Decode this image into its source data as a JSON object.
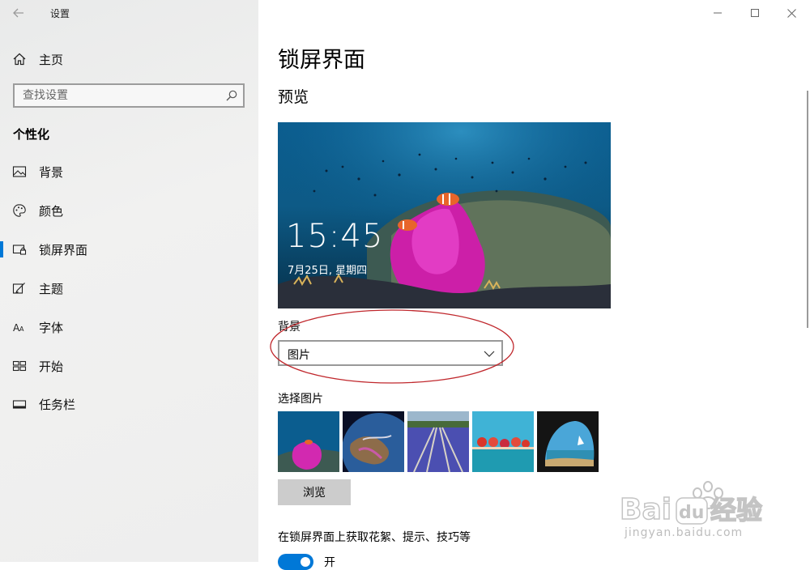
{
  "window": {
    "app_title": "设置",
    "controls": [
      "minimize-icon",
      "maximize-icon",
      "close-icon"
    ]
  },
  "sidebar": {
    "home_label": "主页",
    "search_placeholder": "查找设置",
    "section_title": "个性化",
    "active_index": 2,
    "items": [
      {
        "label": "背景",
        "icon": "picture-icon"
      },
      {
        "label": "颜色",
        "icon": "palette-icon"
      },
      {
        "label": "锁屏界面",
        "icon": "lock-screen-icon"
      },
      {
        "label": "主题",
        "icon": "theme-brush-icon"
      },
      {
        "label": "字体",
        "icon": "font-icon"
      },
      {
        "label": "开始",
        "icon": "start-tiles-icon"
      },
      {
        "label": "任务栏",
        "icon": "taskbar-icon"
      }
    ]
  },
  "main": {
    "page_title": "锁屏界面",
    "preview_title": "预览",
    "preview_time": "15:45",
    "preview_date": "7月25日, 星期四",
    "background_label": "背景",
    "background_value": "图片",
    "choose_picture_label": "选择图片",
    "thumbnails": [
      "coral-reef-thumbnail",
      "earth-from-space-thumbnail",
      "flower-railway-thumbnail",
      "cliff-jumpers-thumbnail",
      "cave-beach-thumbnail"
    ],
    "browse_label": "浏览",
    "tips_label": "在锁屏界面上获取花絮、提示、技巧等",
    "toggle_state": "开"
  },
  "watermark": {
    "logo_text": "Baidu经验",
    "url": "jingyan.baidu.com"
  },
  "colors": {
    "accent": "#0078d7",
    "annotation": "#c0282d",
    "sidebar_bg": "#eeeeee"
  }
}
